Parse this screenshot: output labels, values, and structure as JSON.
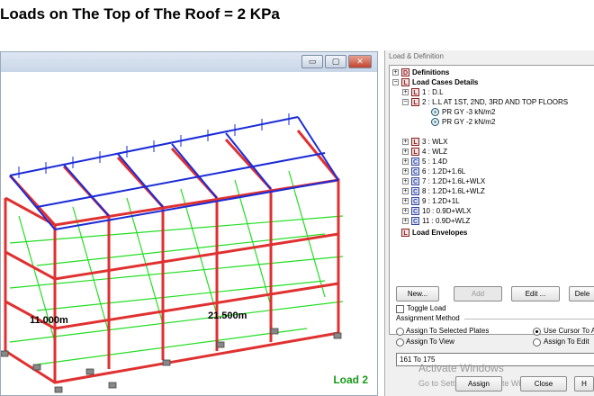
{
  "header": {
    "title": "Loads on The Top of The Roof  = 2 KPa"
  },
  "viewport": {
    "buttons": {
      "minimize": "▭",
      "restore": "▢",
      "close": "✕"
    },
    "dim_left": "11.000m",
    "dim_right": "21.500m",
    "load_name": "Load 2",
    "colors": {
      "roof_load": "#1a2bd8",
      "floor_load": "#22dd22",
      "frame": "#e03030",
      "support": "#888888"
    }
  },
  "panel": {
    "title": "Load & Definition",
    "tree": {
      "definitions": "Definitions",
      "load_cases_details": "Load Cases Details",
      "cases": [
        {
          "label": "1 : D.L",
          "icon": "L"
        },
        {
          "label": "2 : L.L AT 1ST, 2ND, 3RD AND TOP FLOORS",
          "icon": "L"
        },
        {
          "label": "PR GY -3  kN/m2",
          "icon": "P"
        },
        {
          "label": "PR GY -2  kN/m2",
          "icon": "P"
        },
        {
          "label": "3 : WLX",
          "icon": "L"
        },
        {
          "label": "4 : WLZ",
          "icon": "L"
        },
        {
          "label": "5 : 1.4D",
          "icon": "C"
        },
        {
          "label": "6 : 1.2D+1.6L",
          "icon": "C"
        },
        {
          "label": "7 : 1.2D+1.6L+WLX",
          "icon": "C"
        },
        {
          "label": "8 : 1.2D+1.6L+WLZ",
          "icon": "C"
        },
        {
          "label": "9 : 1.2D+1L",
          "icon": "C"
        },
        {
          "label": "10 : 0.9D+WLX",
          "icon": "C"
        },
        {
          "label": "11 : 0.9D+WLZ",
          "icon": "C"
        }
      ],
      "load_envelopes": "Load Envelopes"
    },
    "buttons": {
      "new": "New...",
      "add": "Add",
      "edit": "Edit ...",
      "delete": "Dele"
    },
    "toggle_load": "Toggle Load",
    "assignment_method": "Assignment Method",
    "options": {
      "assign_selected_plates": "Assign To Selected Plates",
      "use_cursor": "Use Cursor To A",
      "assign_to_view": "Assign To View",
      "assign_to_edit": "Assign To Edit"
    },
    "range_value": "161 To 175",
    "watermark": "Activate Windows",
    "watermark_sub": "Go to Settings to activate Windows.",
    "bottom_buttons": {
      "assign": "Assign",
      "close": "Close",
      "help": "H"
    }
  }
}
